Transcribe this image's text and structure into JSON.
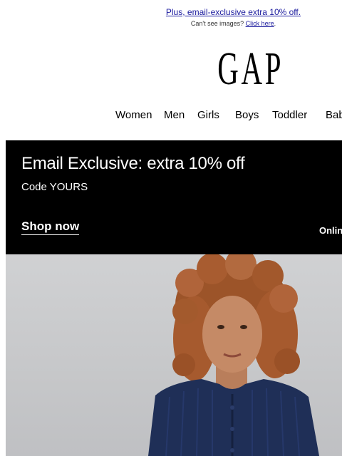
{
  "preheader": {
    "promo_text": "Plus, email-exclusive extra 10% off.",
    "cant_see_text": "Can't see images?",
    "click_here": "Click here",
    "period": "."
  },
  "logo": {
    "text": "GAP"
  },
  "nav": {
    "items": [
      "Women",
      "Men",
      "Girls",
      "Boys",
      "Toddler",
      "Baby"
    ]
  },
  "banner": {
    "headline": "Email Exclusive: extra 10% off",
    "code": "Code YOURS",
    "cta": "Shop now",
    "right_text": "Online"
  },
  "hero": {
    "image": "girl-in-navy-cardigan-photo",
    "colors": {
      "background": "#c9cacc",
      "hair": "#a65a2e",
      "skin": "#c58a66",
      "cardigan": "#1f2f57"
    }
  }
}
